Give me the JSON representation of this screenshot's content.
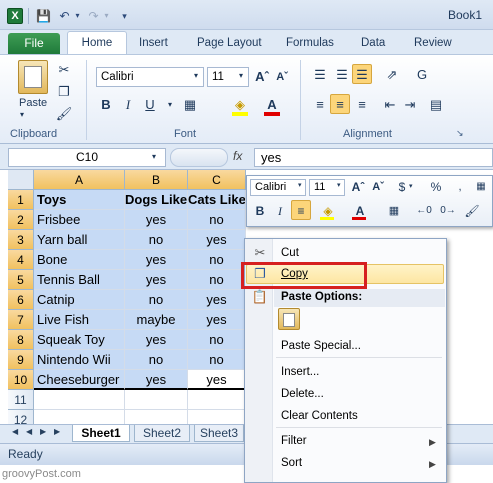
{
  "window": {
    "title": "Book1"
  },
  "quick_access": {
    "save_icon": "save-icon",
    "undo_icon": "undo-icon",
    "redo_icon": "redo-icon"
  },
  "tabs": [
    "File",
    "Home",
    "Insert",
    "Page Layout",
    "Formulas",
    "Data",
    "Review"
  ],
  "ribbon": {
    "clipboard": {
      "paste_label": "Paste",
      "group_label": "Clipboard"
    },
    "font": {
      "name": "Calibri",
      "size": "11",
      "group_label": "Font",
      "bold": "B",
      "italic": "I",
      "underline": "U"
    },
    "alignment": {
      "group_label": "Alignment",
      "wrap_label": "G"
    }
  },
  "formula_bar": {
    "name_box": "C10",
    "fx": "fx",
    "content": "yes"
  },
  "columns": [
    "A",
    "B",
    "C"
  ],
  "rows": [
    {
      "n": "1",
      "a": "Toys",
      "b": "Dogs Like",
      "c": "Cats Like"
    },
    {
      "n": "2",
      "a": "Frisbee",
      "b": "yes",
      "c": "no"
    },
    {
      "n": "3",
      "a": "Yarn ball",
      "b": "no",
      "c": "yes"
    },
    {
      "n": "4",
      "a": "Bone",
      "b": "yes",
      "c": "no"
    },
    {
      "n": "5",
      "a": "Tennis Ball",
      "b": "yes",
      "c": "no"
    },
    {
      "n": "6",
      "a": "Catnip",
      "b": "no",
      "c": "yes"
    },
    {
      "n": "7",
      "a": "Live Fish",
      "b": "maybe",
      "c": "yes"
    },
    {
      "n": "8",
      "a": "Squeak Toy",
      "b": "yes",
      "c": "no"
    },
    {
      "n": "9",
      "a": "Nintendo Wii",
      "b": "no",
      "c": "no"
    },
    {
      "n": "10",
      "a": "Cheeseburger",
      "b": "yes",
      "c": "yes"
    },
    {
      "n": "11",
      "a": "",
      "b": "",
      "c": ""
    },
    {
      "n": "12",
      "a": "",
      "b": "",
      "c": ""
    }
  ],
  "sheets": [
    "Sheet1",
    "Sheet2",
    "Sheet3"
  ],
  "status": "Ready",
  "watermark": "groovyPost.com",
  "mini_toolbar": {
    "font": "Calibri",
    "size": "11",
    "dollar": "$",
    "percent": "%",
    "bold": "B",
    "italic": "I"
  },
  "context_menu": {
    "cut": "Cut",
    "copy": "Copy",
    "paste_options": "Paste Options:",
    "paste_special": "Paste Special...",
    "insert": "Insert...",
    "delete": "Delete...",
    "clear_contents": "Clear Contents",
    "filter": "Filter",
    "sort": "Sort"
  }
}
